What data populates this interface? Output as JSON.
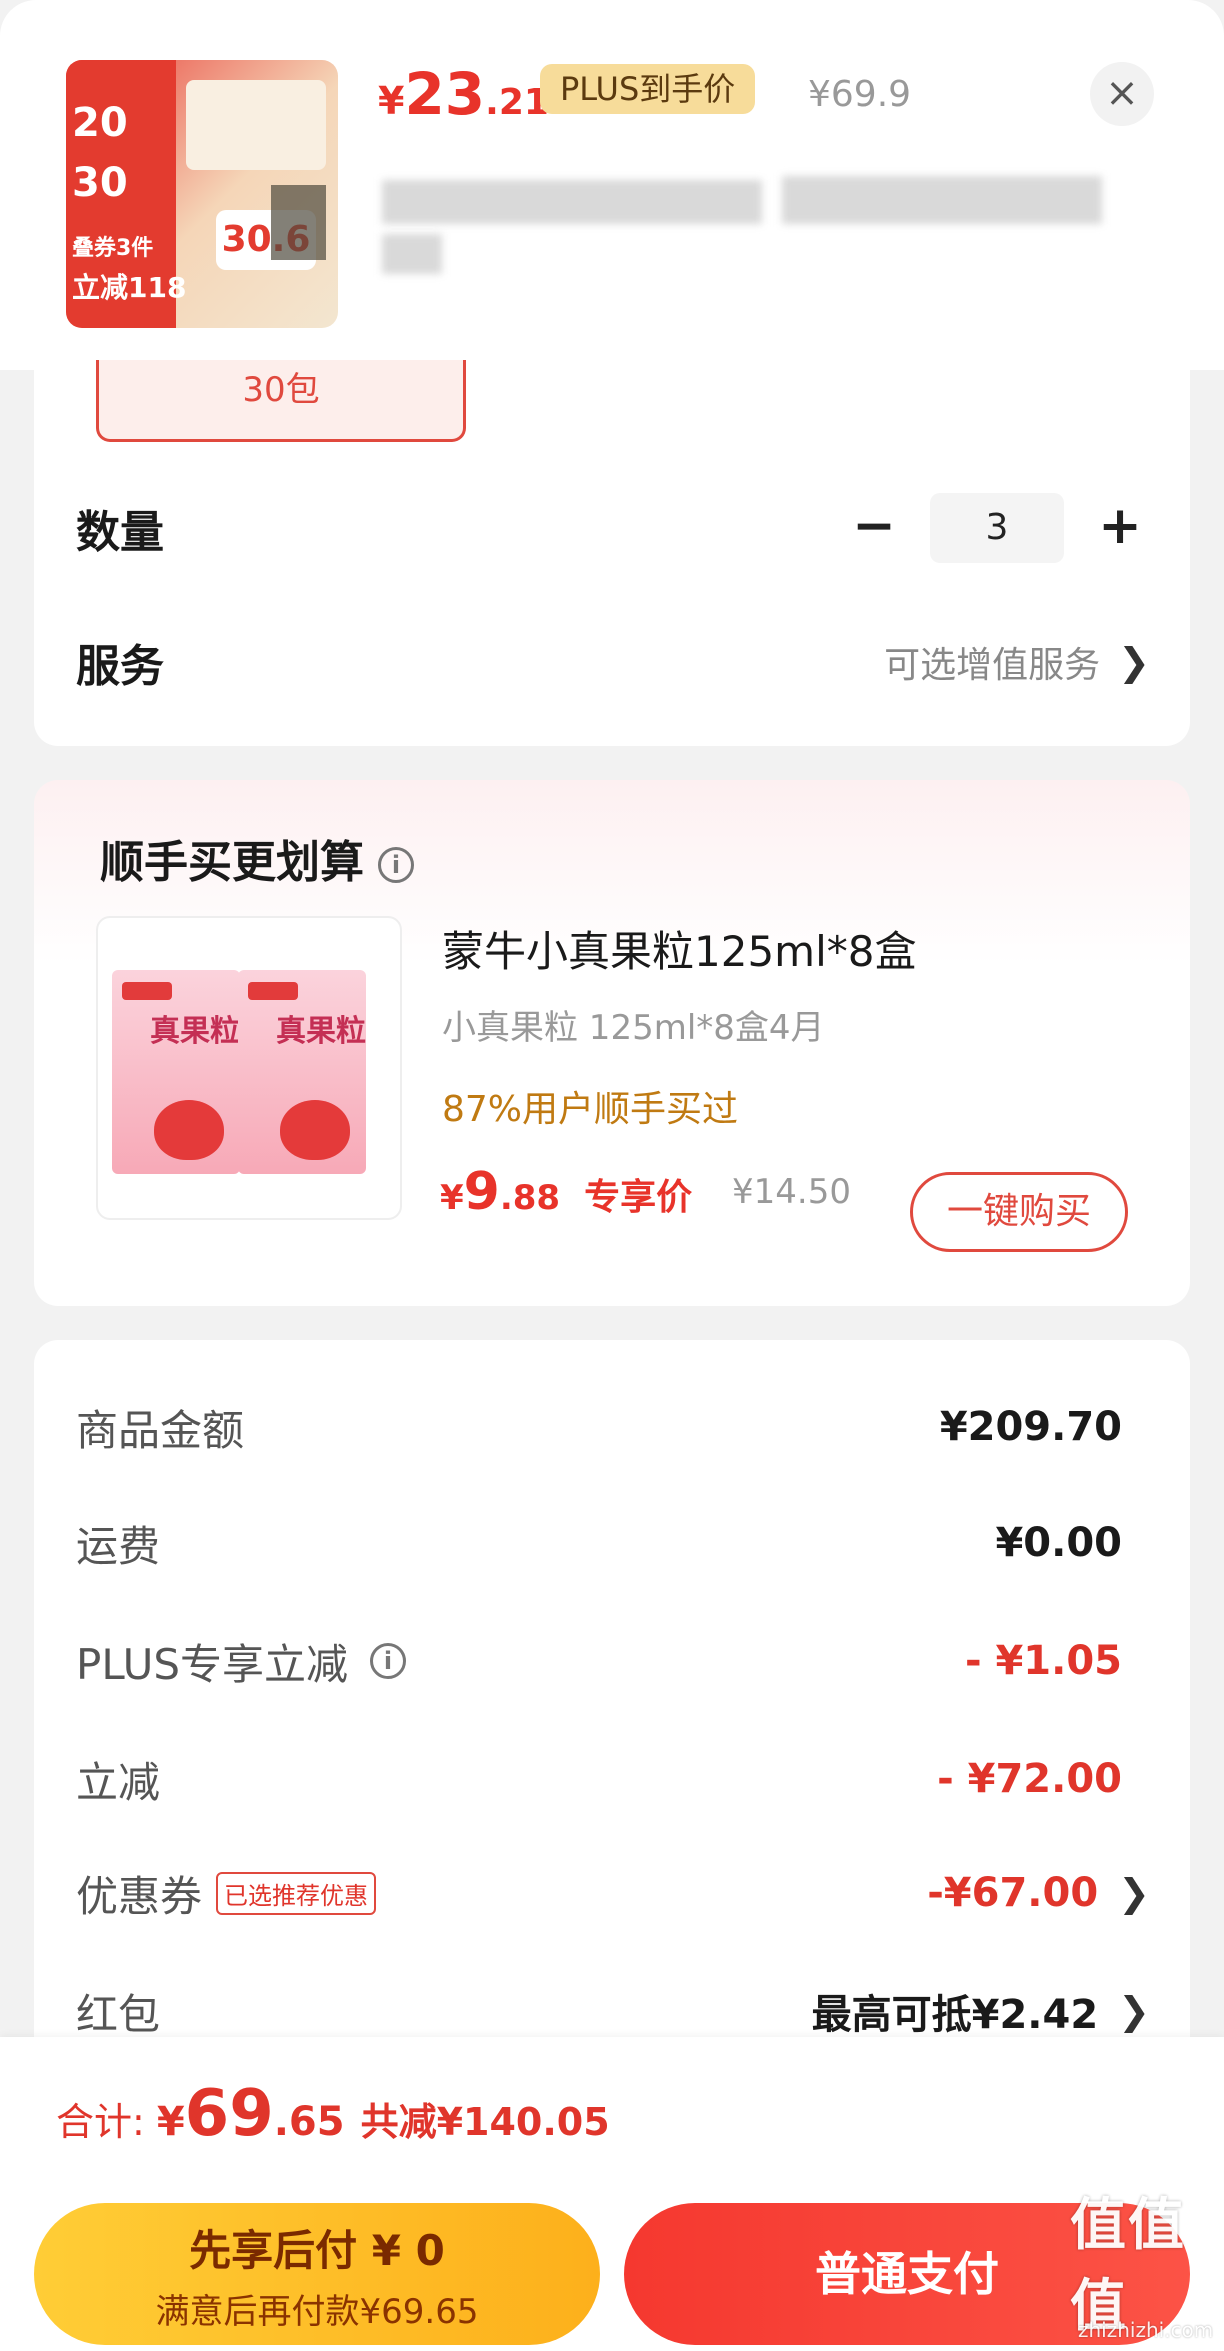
{
  "header": {
    "price_symbol": "¥",
    "price_int": "23",
    "price_dec": ".21",
    "plus_tag": "PLUS到手价",
    "original_price": "¥69.9",
    "close_icon": "close-icon",
    "thumb_badge": "30.6",
    "thumb_lines": [
      "20",
      "30",
      "叠券3件",
      "立减118"
    ]
  },
  "sku": {
    "chip_label": "30包",
    "quantity_label": "数量",
    "quantity_value": "3",
    "minus": "−",
    "plus": "+",
    "service_label": "服务",
    "service_link": "可选增值服务"
  },
  "bundle": {
    "title": "顺手买更划算",
    "product_name": "蒙牛小真果粒125ml*8盒",
    "spec": "小真果粒 125ml*8盒4月",
    "stat": "87%用户顺手买过",
    "price_symbol": "¥",
    "price_int": "9",
    "price_dec": ".88",
    "exclusive": "专享价",
    "original_price": "¥14.50",
    "buy_button": "一键购买",
    "box_label": "真果粒"
  },
  "summary": {
    "rows": [
      {
        "label": "商品金额",
        "value": "¥209.70"
      },
      {
        "label": "运费",
        "value": "¥0.00"
      },
      {
        "label": "PLUS专享立减",
        "value": "- ¥1.05"
      },
      {
        "label": "立减",
        "value": "- ¥72.00"
      },
      {
        "label": "优惠券",
        "tag": "已选推荐优惠",
        "value": "-¥67.00"
      },
      {
        "label": "红包",
        "value": "最高可抵¥2.42"
      }
    ]
  },
  "bottom": {
    "total_label": "合计:",
    "total_symbol": "¥",
    "total_int": "69",
    "total_dec": ".65",
    "total_saving": "共减¥140.05",
    "pay_later_title": "先享后付 ¥ 0",
    "pay_later_sub": "满意后再付款¥69.65",
    "pay_normal": "普通支付"
  },
  "watermark": {
    "main": "值值值",
    "sub": "zhizhizhi.com"
  },
  "colors": {
    "accent_red": "#e8332a",
    "gold": "#fdb01b",
    "plus_tag_bg": "#f7dc9a"
  }
}
